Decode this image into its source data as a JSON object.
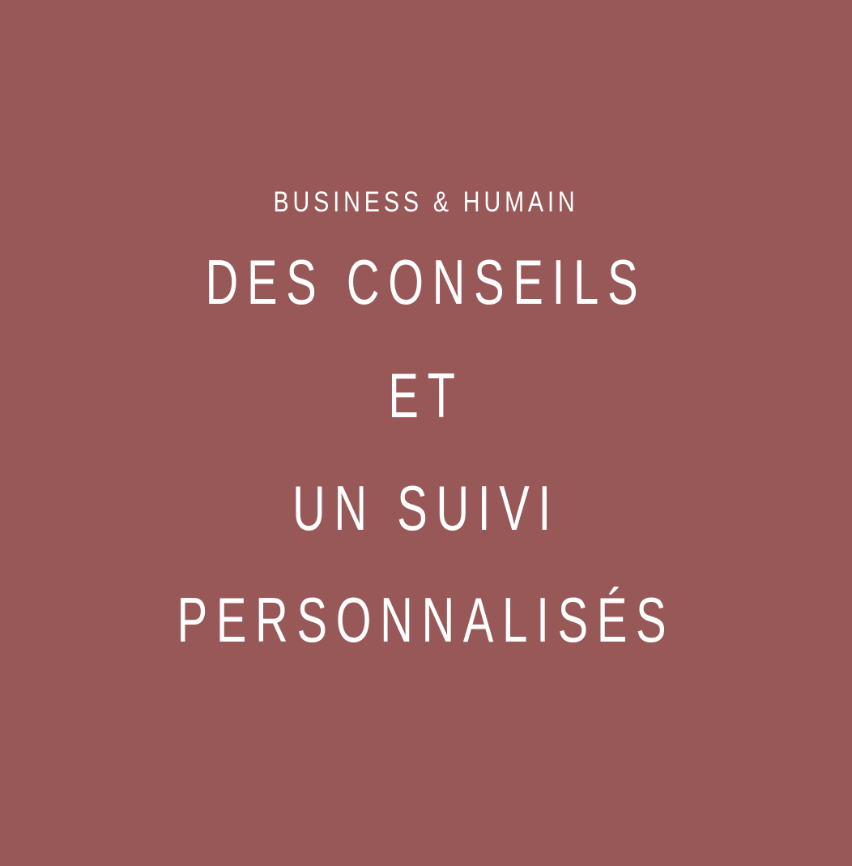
{
  "background_color": "#995858",
  "text_color": "#ffffff",
  "subtitle": "BUSINESS & HUMAIN",
  "headline": {
    "line1": "DES CONSEILS",
    "line2": "ET",
    "line3": "UN SUIVI",
    "line4": "PERSONNALISÉS"
  }
}
